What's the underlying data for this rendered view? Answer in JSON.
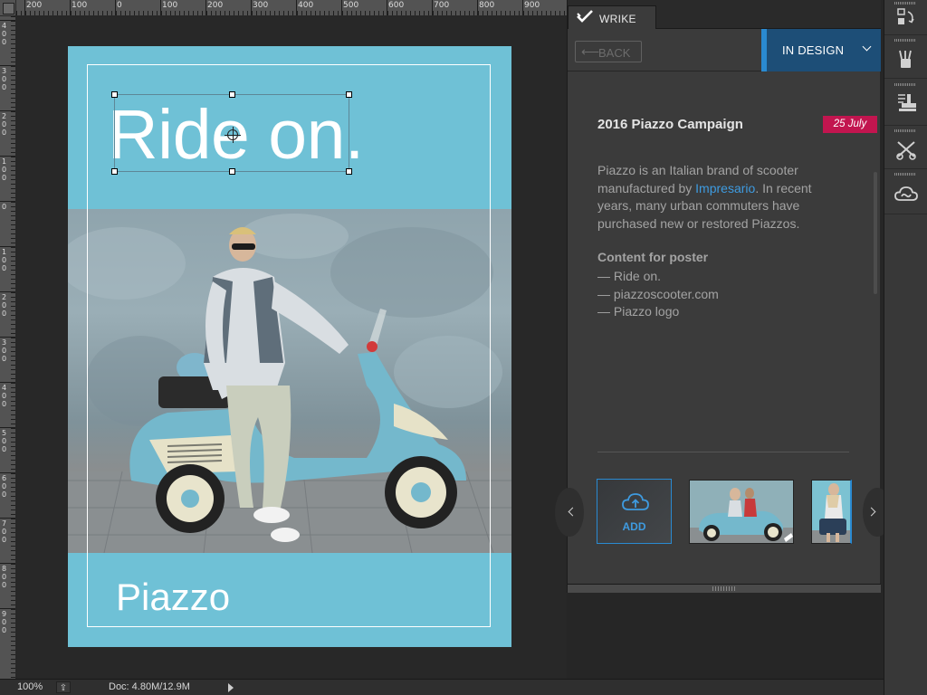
{
  "rulers": {
    "top_labels": [
      "200",
      "100",
      "0",
      "100",
      "200",
      "300",
      "400",
      "500",
      "600",
      "700",
      "800",
      "900"
    ],
    "left_labels": [
      "4 0 0",
      "3 0 0",
      "2 0 0",
      "1 0 0",
      "0",
      "1 0 0",
      "2 0 0",
      "3 0 0",
      "4 0 0",
      "5 0 0",
      "6 0 0",
      "7 0 0",
      "8 0 0",
      "9 0 0"
    ]
  },
  "poster": {
    "headline": "Ride on.",
    "brand": "Piazzo",
    "background_color": "#6fc1d6"
  },
  "statusbar": {
    "zoom": "100%",
    "doc_info": "Doc: 4.80M/12.9M"
  },
  "wrike": {
    "tab_label": "WRIKE",
    "back_label": "BACK",
    "status": "IN DESIGN",
    "status_color": "#1d4e77",
    "task": {
      "title": "2016 Piazzo Campaign",
      "due_date": "25 July",
      "due_color": "#c2154f",
      "description_before": "Piazzo is an Italian brand of scooter manufactured by ",
      "description_link": "Impresario",
      "description_after": ". In recent years, many urban commuters have purchased new or restored Piazzos.",
      "content_heading": "Content for poster",
      "content_items": [
        "— Ride on.",
        "— piazzoscooter.com",
        "— Piazzo logo"
      ]
    },
    "attachments": {
      "add_label": "ADD"
    }
  },
  "icons": {
    "wrike_logo": "checkmark-icon",
    "back": "arrow-left-icon",
    "dropdown": "chevron-down-icon",
    "prev": "chevron-left-icon",
    "next": "chevron-right-icon",
    "upload": "cloud-upload-icon",
    "tools": [
      "history-icon",
      "brush-icon",
      "stamp-icon",
      "scissors-tools-icon",
      "creative-cloud-icon"
    ]
  }
}
